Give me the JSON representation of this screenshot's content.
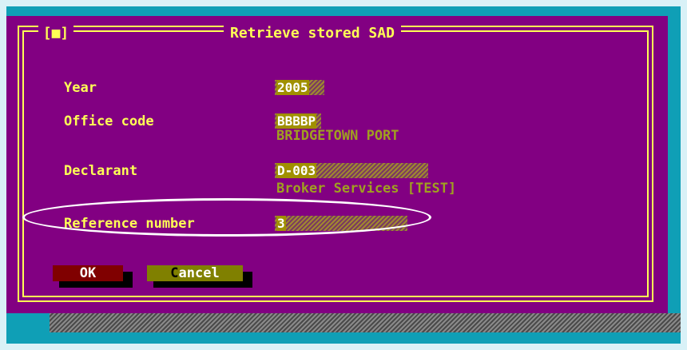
{
  "dialog": {
    "close_label": "[■]",
    "title": "Retrieve stored SAD"
  },
  "fields": {
    "year": {
      "label": "Year",
      "value": "2005"
    },
    "office_code": {
      "label": "Office code",
      "value": "BBBBP",
      "description": "BRIDGETOWN PORT"
    },
    "declarant": {
      "label": "Declarant",
      "value": "D-003",
      "description": "Broker Services [TEST]"
    },
    "reference_number": {
      "label": "Reference number",
      "value": "3"
    }
  },
  "buttons": {
    "ok_hot": "O",
    "ok_rest": "K",
    "cancel_hot": "C",
    "cancel_rest": "ancel"
  },
  "colors": {
    "dialog_bg": "#820082",
    "border": "#ffff55",
    "desktop": "#0f9fb6",
    "annotation": "#ffffff"
  }
}
